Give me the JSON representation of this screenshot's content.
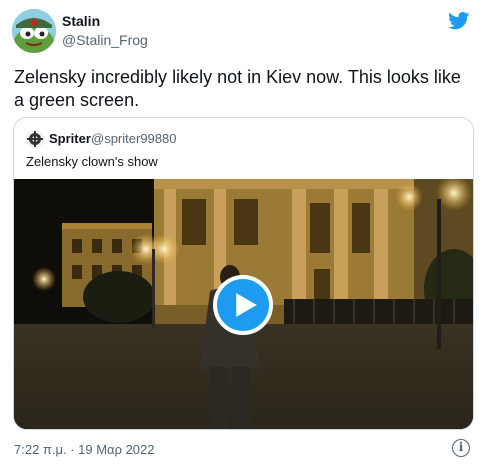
{
  "author": {
    "name": "Stalin",
    "handle": "@Stalin_Frog",
    "avatar_icon": "frog-with-star-cap-avatar"
  },
  "brand": {
    "icon": "twitter-bird-icon",
    "color": "#1d9bf0"
  },
  "tweet": {
    "text": "Zelensky incredibly likely not in Kiev now. This looks like a green screen."
  },
  "quoted": {
    "name": "Spriter",
    "handle": "@spriter99880",
    "text": "Zelensky clown's show",
    "avatar_icon": "spriter-logo-avatar",
    "media": {
      "type": "video",
      "play_icon": "play-icon",
      "play_color": "#1d9bf0"
    }
  },
  "footer": {
    "timestamp": "7:22 π.μ. · 19 Μαρ 2022",
    "info_icon": "info-icon",
    "info_glyph": "i"
  }
}
